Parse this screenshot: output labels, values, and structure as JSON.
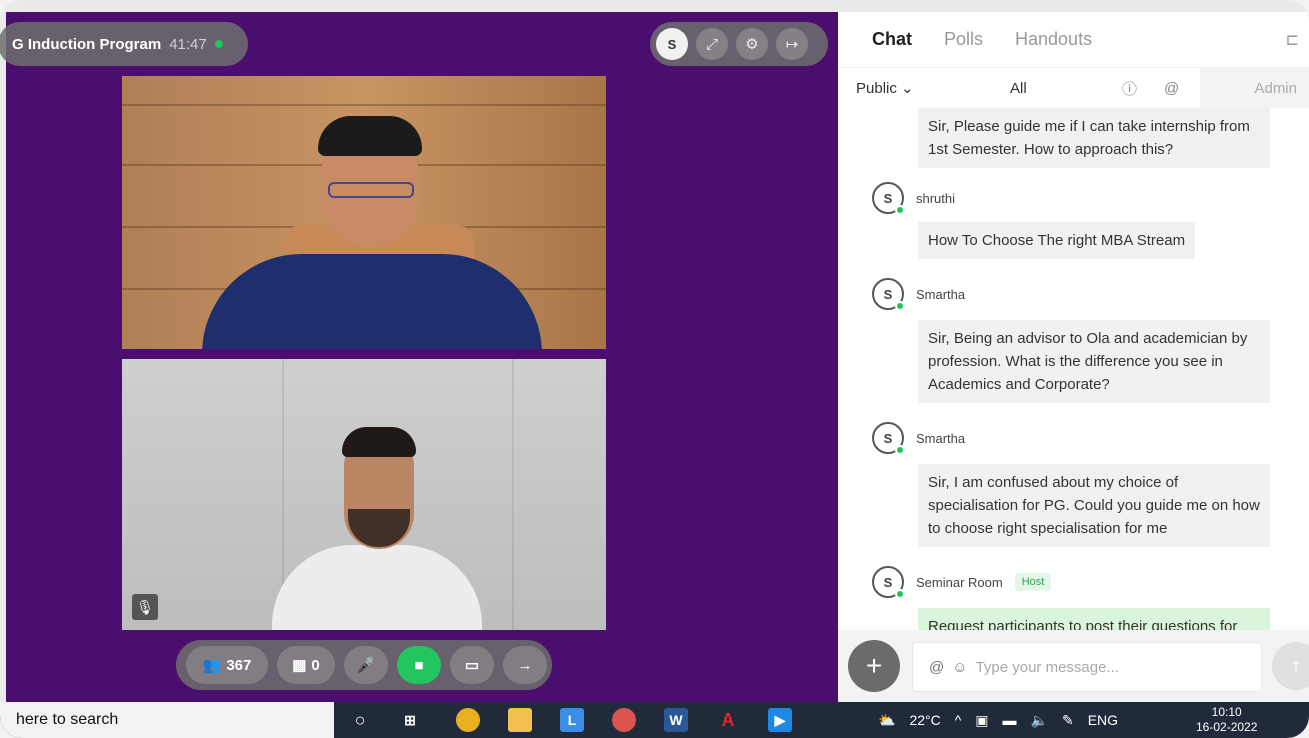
{
  "session": {
    "title": "G Induction Program",
    "timer": "41:47"
  },
  "top_tools": {
    "avatar_letter": "S"
  },
  "bottom_bar": {
    "participants_count": "367",
    "breakout_count": "0"
  },
  "chat": {
    "tabs": [
      "Chat",
      "Polls",
      "Handouts"
    ],
    "filter_audience": "Public",
    "filter_scope": "All",
    "admin_label": "Admin",
    "messages": [
      {
        "sender": "",
        "text": "Sir, Please guide me if I can take internship from 1st Semester. How to approach this?"
      },
      {
        "sender": "shruthi",
        "avatar": "S",
        "text": "How To Choose The right MBA Stream"
      },
      {
        "sender": "Smartha",
        "avatar": "S",
        "text": "Sir, Being an advisor to Ola and academician by profession. What is the difference you see in Academics and Corporate?"
      },
      {
        "sender": "Smartha",
        "avatar": "S",
        "text": "Sir, I am confused about my choice of specialisation for PG. Could you guide me on how to choose right specialisation for me"
      },
      {
        "sender": "Seminar Room",
        "avatar": "S",
        "tag": "Host",
        "text": "Request participants to post their questions for"
      }
    ],
    "compose_placeholder": "Type your message..."
  },
  "taskbar": {
    "search_text": "here to search",
    "weather": "22°C",
    "language": "ENG",
    "time": "10:10",
    "date": "16-02-2022"
  }
}
